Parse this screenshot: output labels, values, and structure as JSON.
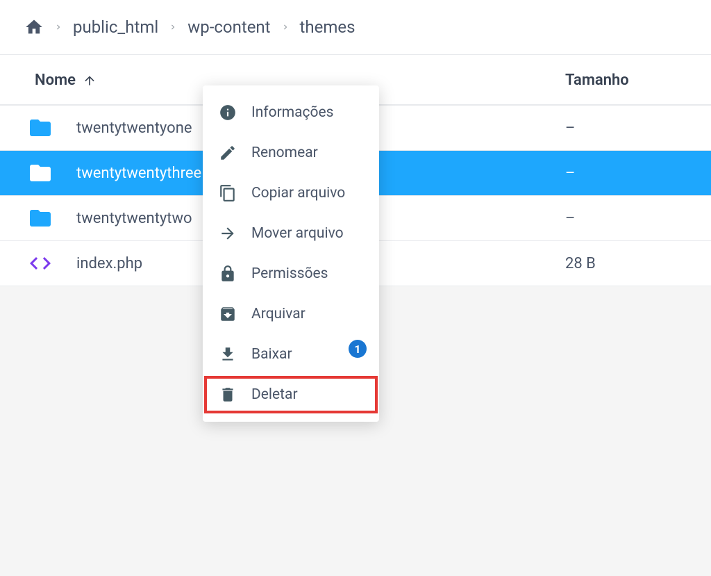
{
  "breadcrumb": {
    "items": [
      "public_html",
      "wp-content",
      "themes"
    ]
  },
  "columns": {
    "name": "Nome",
    "size": "Tamanho"
  },
  "rows": [
    {
      "type": "folder",
      "name": "twentytwentyone",
      "size": "–",
      "selected": false
    },
    {
      "type": "folder",
      "name": "twentytwentythree",
      "size": "–",
      "selected": true
    },
    {
      "type": "folder",
      "name": "twentytwentytwo",
      "size": "–",
      "selected": false
    },
    {
      "type": "code",
      "name": "index.php",
      "size": "28 B",
      "selected": false
    }
  ],
  "context_menu": {
    "items": [
      {
        "icon": "info",
        "label": "Informações"
      },
      {
        "icon": "rename",
        "label": "Renomear"
      },
      {
        "icon": "copy",
        "label": "Copiar arquivo"
      },
      {
        "icon": "move",
        "label": "Mover arquivo"
      },
      {
        "icon": "lock",
        "label": "Permissões"
      },
      {
        "icon": "archive",
        "label": "Arquivar"
      },
      {
        "icon": "download",
        "label": "Baixar"
      },
      {
        "icon": "delete",
        "label": "Deletar",
        "highlighted": true
      }
    ],
    "annotation_badge": "1"
  },
  "colors": {
    "accent": "#1ea7fd",
    "folder": "#1ea7fd",
    "code": "#7c3aed",
    "menu_icon": "#455a64",
    "highlight_box": "#e53935",
    "badge": "#1976d2"
  }
}
